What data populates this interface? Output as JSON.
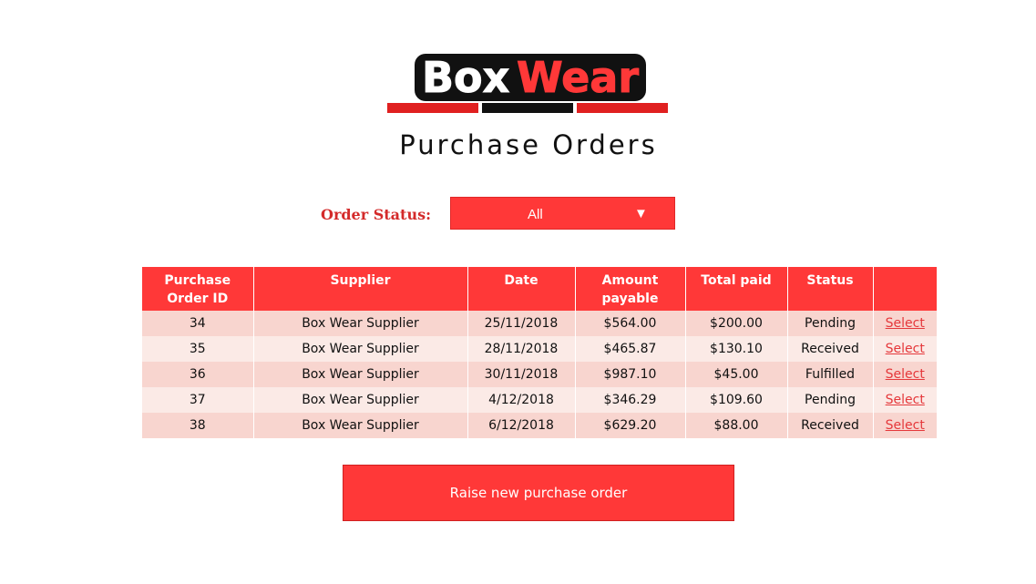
{
  "logo": {
    "part1": "Box",
    "part2": "Wear",
    "colors": {
      "black": "#111111",
      "red": "#ff3838"
    }
  },
  "page_title": "Purchase Orders",
  "filter": {
    "label": "Order Status:",
    "selected": "All",
    "arrow_icon": "▼"
  },
  "table": {
    "headers": [
      "Purchase Order ID",
      "Supplier",
      "Date",
      "Amount payable",
      "Total paid",
      "Status",
      ""
    ],
    "rows": [
      {
        "id": "34",
        "supplier": "Box Wear Supplier",
        "date": "25/11/2018",
        "amount": "$564.00",
        "paid": "$200.00",
        "status": "Pending",
        "action": "Select"
      },
      {
        "id": "35",
        "supplier": "Box Wear Supplier",
        "date": "28/11/2018",
        "amount": "$465.87",
        "paid": "$130.10",
        "status": "Received",
        "action": "Select"
      },
      {
        "id": "36",
        "supplier": "Box Wear Supplier",
        "date": "30/11/2018",
        "amount": "$987.10",
        "paid": "$45.00",
        "status": "Fulfilled",
        "action": "Select"
      },
      {
        "id": "37",
        "supplier": "Box Wear Supplier",
        "date": "4/12/2018",
        "amount": "$346.29",
        "paid": "$109.60",
        "status": "Pending",
        "action": "Select"
      },
      {
        "id": "38",
        "supplier": "Box Wear Supplier",
        "date": "6/12/2018",
        "amount": "$629.20",
        "paid": "$88.00",
        "status": "Received",
        "action": "Select"
      }
    ]
  },
  "actions": {
    "raise_label": "Raise new purchase order"
  },
  "colors": {
    "accent": "#ff3838",
    "row_odd": "#f8d5cf",
    "row_even": "#fbeae6"
  }
}
